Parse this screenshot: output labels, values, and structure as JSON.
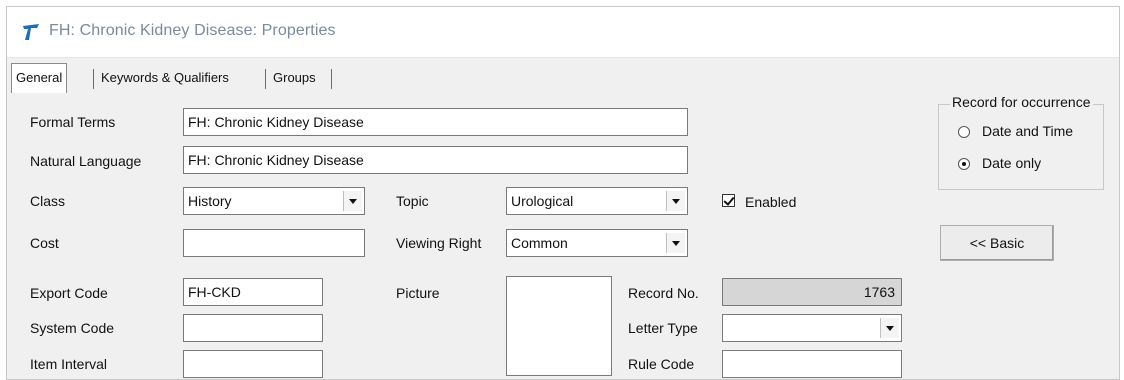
{
  "window": {
    "title": "FH: Chronic Kidney Disease: Properties"
  },
  "tabs": [
    {
      "label": "General",
      "active": true
    },
    {
      "label": "Keywords & Qualifiers",
      "active": false
    },
    {
      "label": "Groups",
      "active": false
    }
  ],
  "form": {
    "formal_terms": {
      "label": "Formal Terms",
      "value": "FH: Chronic Kidney Disease"
    },
    "natural_language": {
      "label": "Natural Language",
      "value": "FH: Chronic Kidney Disease"
    },
    "class": {
      "label": "Class",
      "value": "History"
    },
    "topic": {
      "label": "Topic",
      "value": "Urological"
    },
    "enabled": {
      "label": "Enabled",
      "checked": true
    },
    "cost": {
      "label": "Cost",
      "value": ""
    },
    "viewing_right": {
      "label": "Viewing Right",
      "value": "Common"
    },
    "export_code": {
      "label": "Export Code",
      "value": "FH-CKD"
    },
    "system_code": {
      "label": "System Code",
      "value": ""
    },
    "item_interval": {
      "label": "Item Interval",
      "value": ""
    },
    "picture": {
      "label": "Picture"
    },
    "record_no": {
      "label": "Record No.",
      "value": "1763"
    },
    "letter_type": {
      "label": "Letter Type",
      "value": ""
    },
    "rule_code": {
      "label": "Rule Code",
      "value": ""
    }
  },
  "record_for_occurrence": {
    "title": "Record for occurrence",
    "options": [
      {
        "label": "Date and Time",
        "selected": false
      },
      {
        "label": "Date only",
        "selected": true
      }
    ]
  },
  "basic_button": {
    "label": "<< Basic"
  },
  "colors": {
    "app_icon": "#1d6fb8",
    "title_text": "#7b8a9c"
  },
  "icons": {
    "app": "telstra-logo-icon"
  }
}
